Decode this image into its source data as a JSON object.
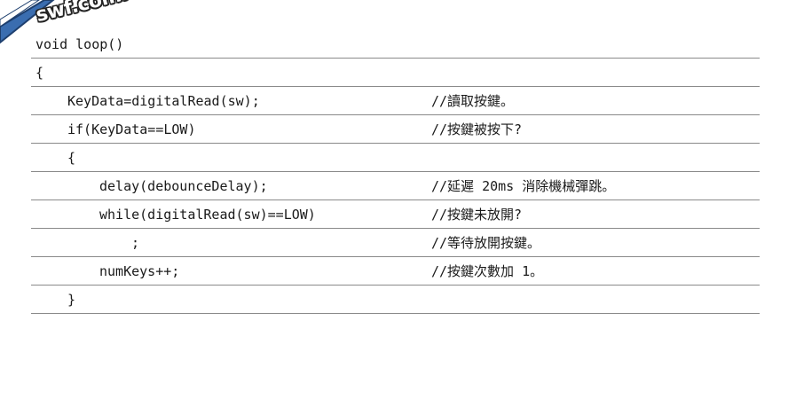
{
  "logo": {
    "text": "swf.com.tw"
  },
  "code_lines": [
    {
      "code": "void loop()",
      "comment": ""
    },
    {
      "code": "{",
      "comment": ""
    },
    {
      "code": "KeyData=digitalRead(sw);",
      "comment": "//讀取按鍵。"
    },
    {
      "code": "if(KeyData==LOW)",
      "comment": "//按鍵被按下?"
    },
    {
      "code": "{",
      "comment": ""
    },
    {
      "code": "delay(debounceDelay);",
      "comment": "//延遲 20ms 消除機械彈跳。"
    },
    {
      "code": "while(digitalRead(sw)==LOW)",
      "comment": "//按鍵未放開?"
    },
    {
      "code": ";",
      "comment": "//等待放開按鍵。"
    },
    {
      "code": "numKeys++;",
      "comment": "//按鍵次數加 1。"
    },
    {
      "code": "}",
      "comment": ""
    }
  ]
}
